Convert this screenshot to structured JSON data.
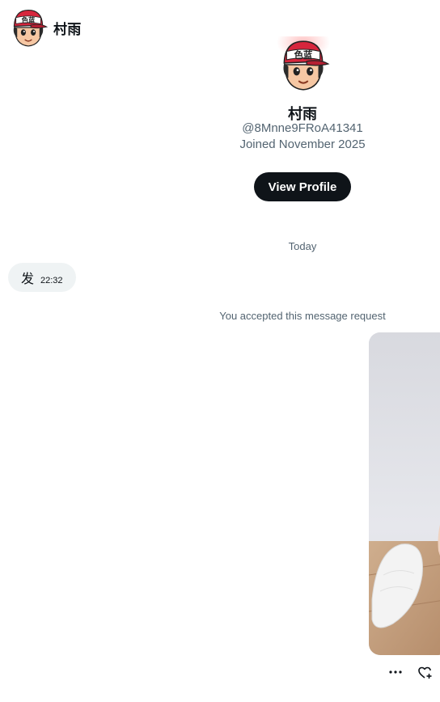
{
  "header": {
    "avatar_icon": "cartoon-avatar-icon",
    "name": "村雨"
  },
  "profile": {
    "avatar_icon": "cartoon-avatar-icon",
    "cap_text": "色蓝",
    "name": "村雨",
    "handle": "@8Mnne9FRoA41341",
    "joined": "Joined November 2025",
    "view_profile_label": "View Profile"
  },
  "conversation": {
    "date_divider": "Today",
    "messages": [
      {
        "text": "发",
        "time": "22:32"
      }
    ],
    "system_note": "You accepted this message request"
  },
  "media": {
    "more_icon": "more-horizontal-icon",
    "react_icon": "heart-plus-icon"
  },
  "colors": {
    "primary_text": "#0f1419",
    "secondary_text": "#536471",
    "bubble_bg": "#eff3f4",
    "button_bg": "#0f1419",
    "cap_red": "#d7263d"
  }
}
